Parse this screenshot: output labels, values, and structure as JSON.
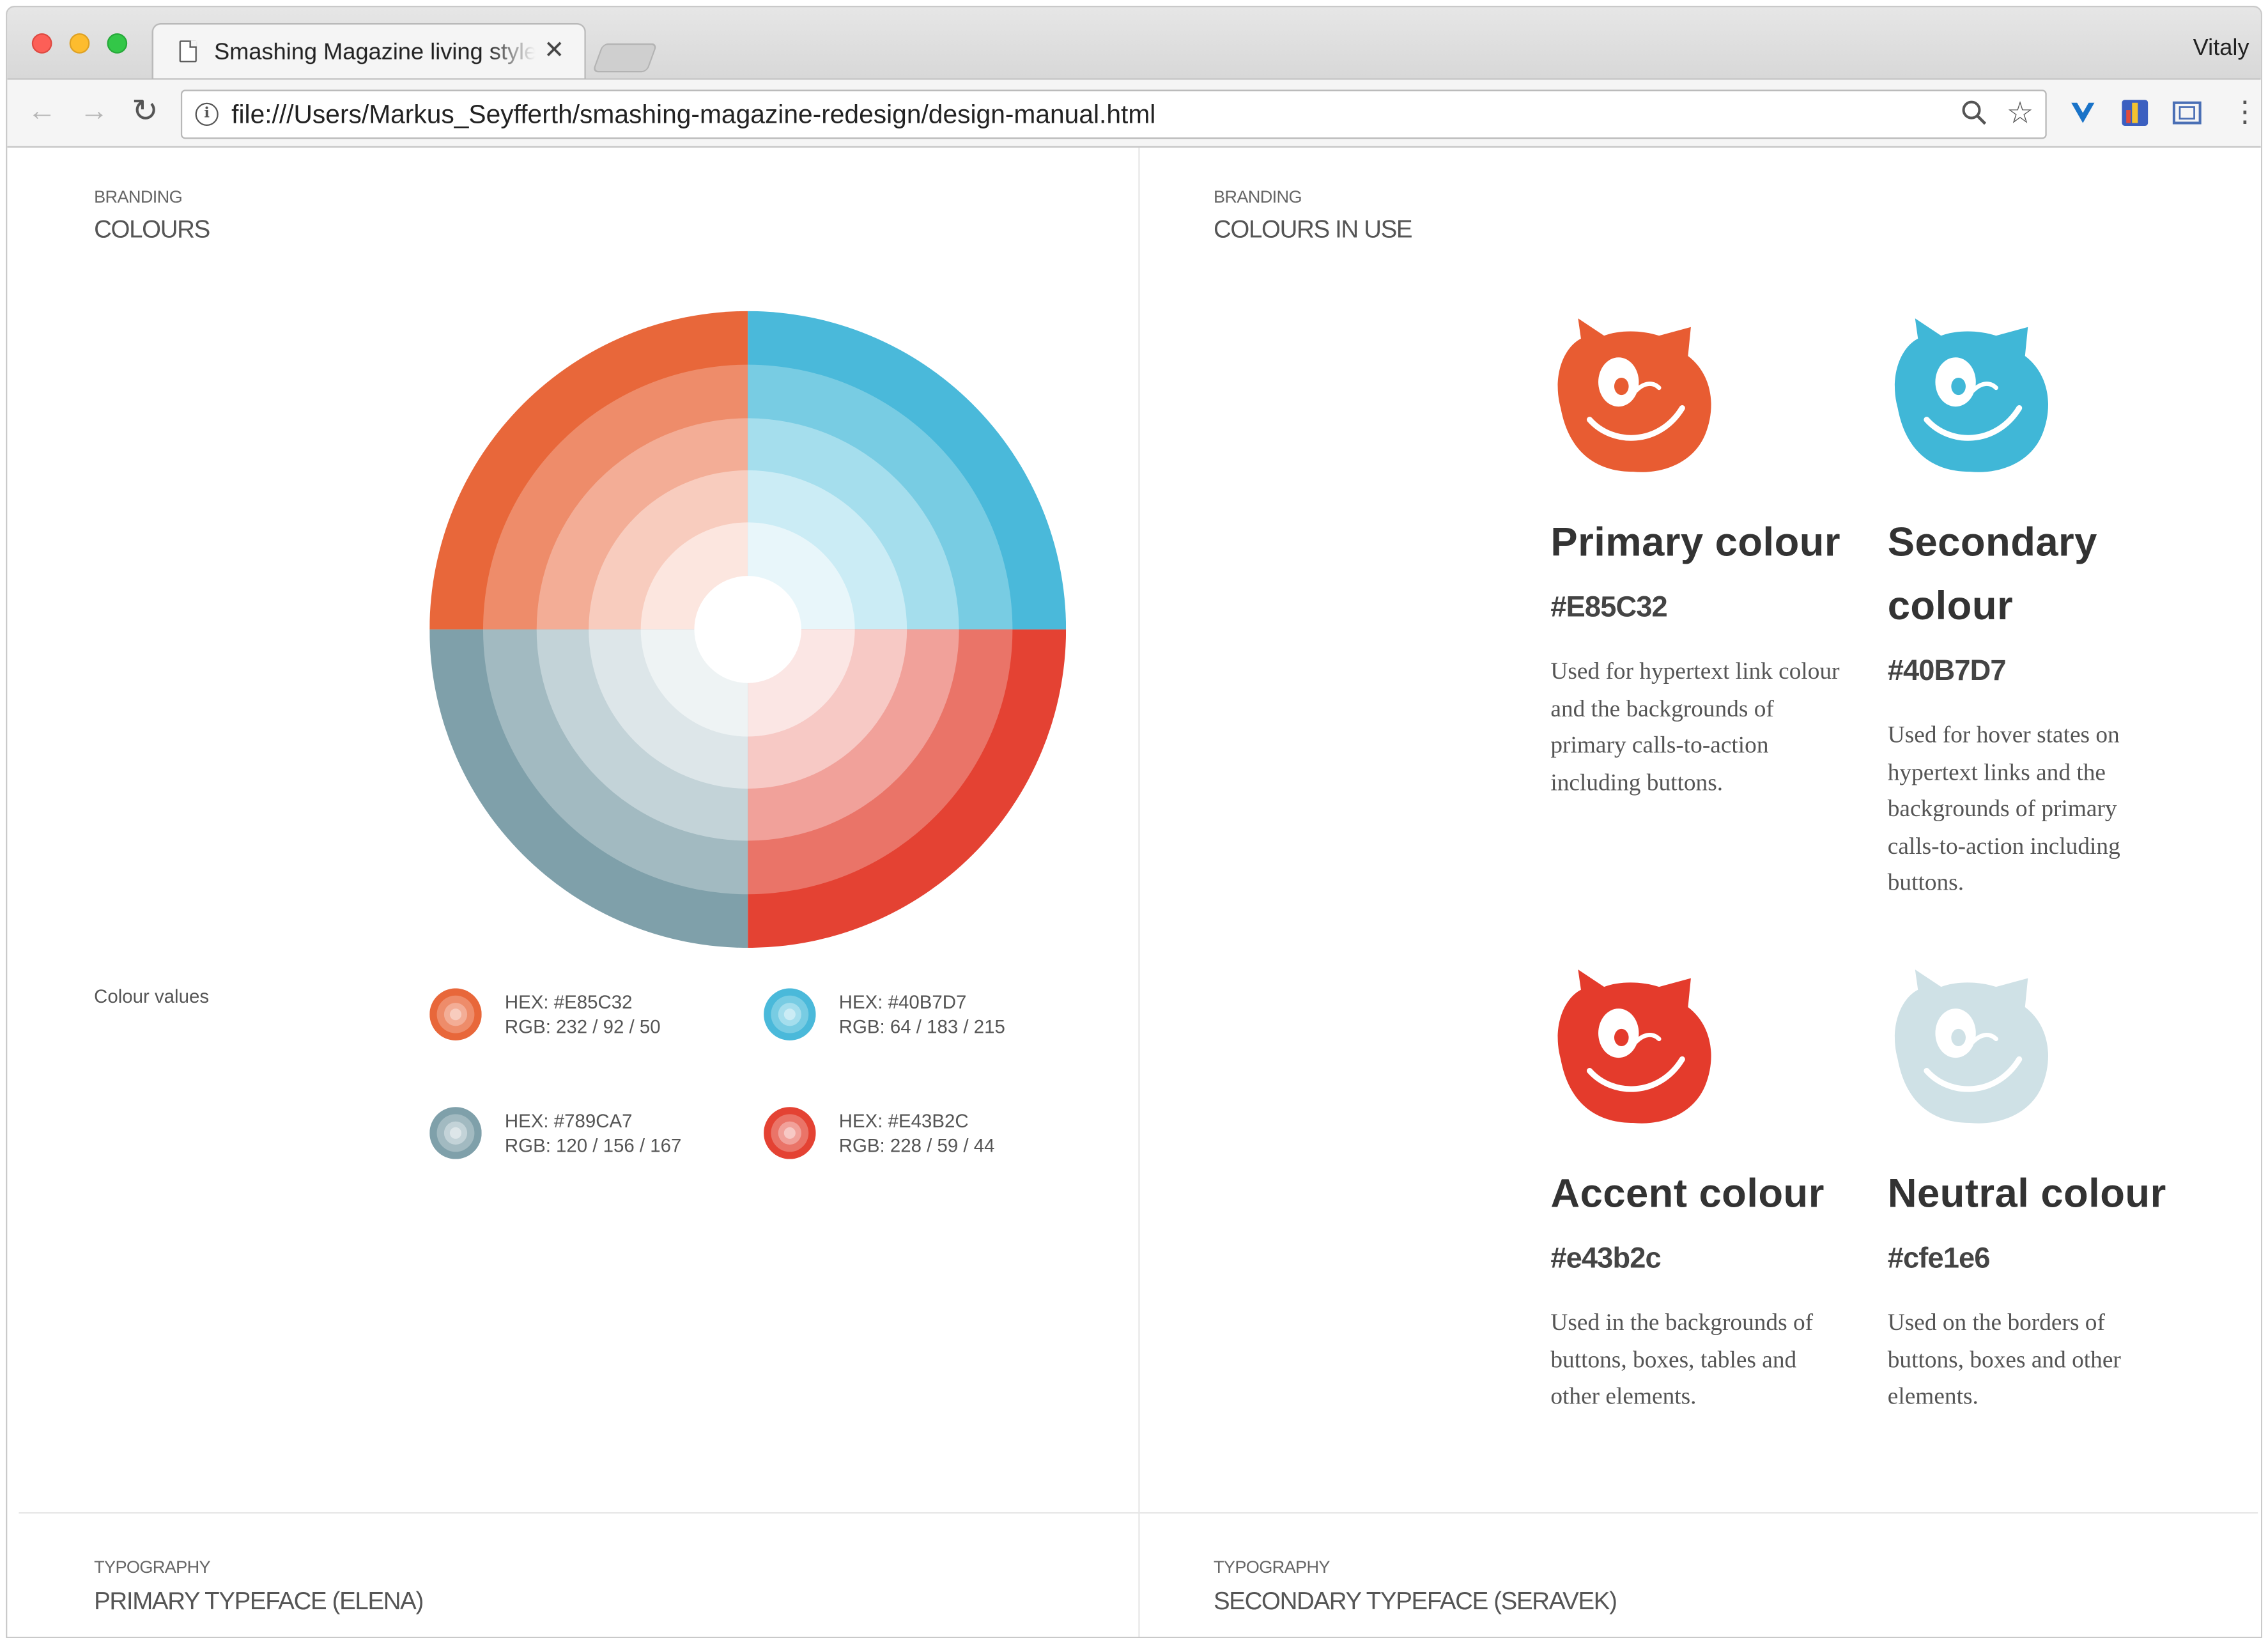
{
  "browser": {
    "tab_title": "Smashing Magazine living style guide",
    "profile_name": "Vitaly",
    "url": "file:///Users/Markus_Seyfferth/smashing-magazine-redesign/design-manual.html"
  },
  "left_section": {
    "eyebrow": "BRANDING",
    "title": "COLOURS",
    "colour_values_label": "Colour values",
    "swatches": [
      {
        "hex": "HEX: #E85C32",
        "rgb": "RGB: 232 / 92 / 50",
        "color": "#E85C32"
      },
      {
        "hex": "HEX: #40B7D7",
        "rgb": "RGB: 64 / 183 / 215",
        "color": "#40B7D7"
      },
      {
        "hex": "HEX: #789CA7",
        "rgb": "RGB: 120 / 156 / 167",
        "color": "#789CA7"
      },
      {
        "hex": "HEX: #E43B2C",
        "rgb": "RGB: 228 / 59 / 44",
        "color": "#E43B2C"
      }
    ]
  },
  "right_section": {
    "eyebrow": "BRANDING",
    "title": "COLOURS IN USE",
    "colours": [
      {
        "name": "Primary colour",
        "hex": "#E85C32",
        "description": "Used for hypertext link colour and the backgrounds of primary calls-to-action including buttons.",
        "color": "#E85C32"
      },
      {
        "name": "Secondary colour",
        "hex": "#40B7D7",
        "description": "Used for hover states on hypertext links and the backgrounds of primary calls-to-action including buttons.",
        "color": "#40B7D7"
      },
      {
        "name": "Accent colour",
        "hex": "#e43b2c",
        "description": "Used in the backgrounds of buttons, boxes, tables and other elements.",
        "color": "#e43b2c"
      },
      {
        "name": "Neutral colour",
        "hex": "#cfe1e6",
        "description": "Used on the borders of buttons, boxes and other elements.",
        "color": "#cfe1e6"
      }
    ]
  },
  "bottom_left": {
    "eyebrow": "TYPOGRAPHY",
    "title": "PRIMARY TYPEFACE (ELENA)"
  },
  "bottom_right": {
    "eyebrow": "TYPOGRAPHY",
    "title": "SECONDARY TYPEFACE (SERAVEK)"
  },
  "icons": [
    "document-icon",
    "close-icon",
    "back-arrow-icon",
    "forward-arrow-icon",
    "reload-icon",
    "info-icon",
    "zoom-icon",
    "star-icon",
    "extension-icon",
    "menu-icon",
    "cat-mascot-icon"
  ]
}
